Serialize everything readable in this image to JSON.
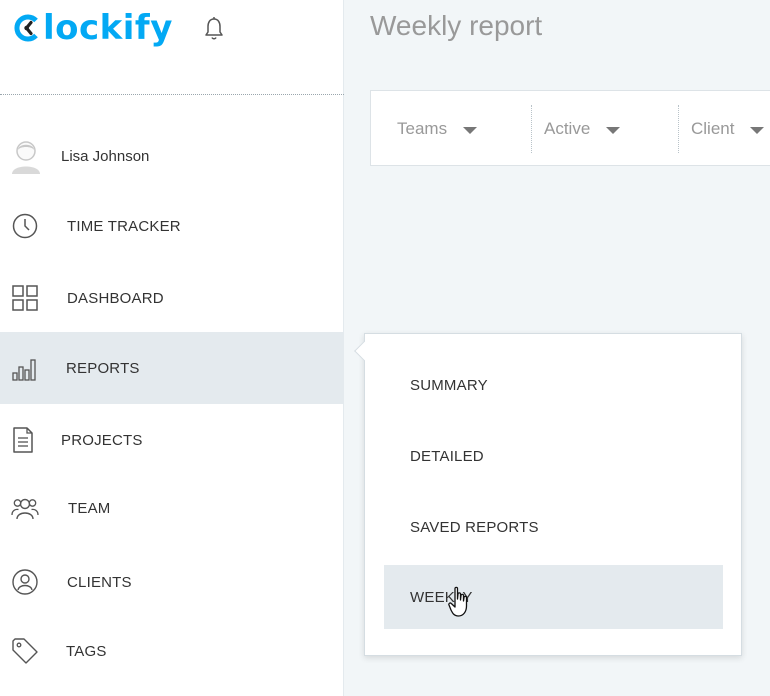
{
  "app": {
    "logo_text": "lockify",
    "accent_color": "#03a9f4"
  },
  "page": {
    "title": "Weekly report"
  },
  "user": {
    "name": "Lisa Johnson",
    "avatar_icon": "user-avatar-icon"
  },
  "sidebar": {
    "items": [
      {
        "label": "TIME TRACKER",
        "icon": "clock-icon"
      },
      {
        "label": "DASHBOARD",
        "icon": "dashboard-grid-icon"
      },
      {
        "label": "REPORTS",
        "icon": "bar-chart-icon",
        "active": true
      },
      {
        "label": "PROJECTS",
        "icon": "document-icon"
      },
      {
        "label": "TEAM",
        "icon": "team-icon"
      },
      {
        "label": "CLIENTS",
        "icon": "client-icon"
      },
      {
        "label": "TAGS",
        "icon": "tag-icon"
      }
    ]
  },
  "filters": [
    {
      "label": "Teams"
    },
    {
      "label": "Active"
    },
    {
      "label": "Client"
    }
  ],
  "reports_menu": {
    "items": [
      {
        "label": "SUMMARY"
      },
      {
        "label": "DETAILED"
      },
      {
        "label": "SAVED REPORTS"
      },
      {
        "label": "WEEKLY",
        "hovered": true
      }
    ]
  }
}
